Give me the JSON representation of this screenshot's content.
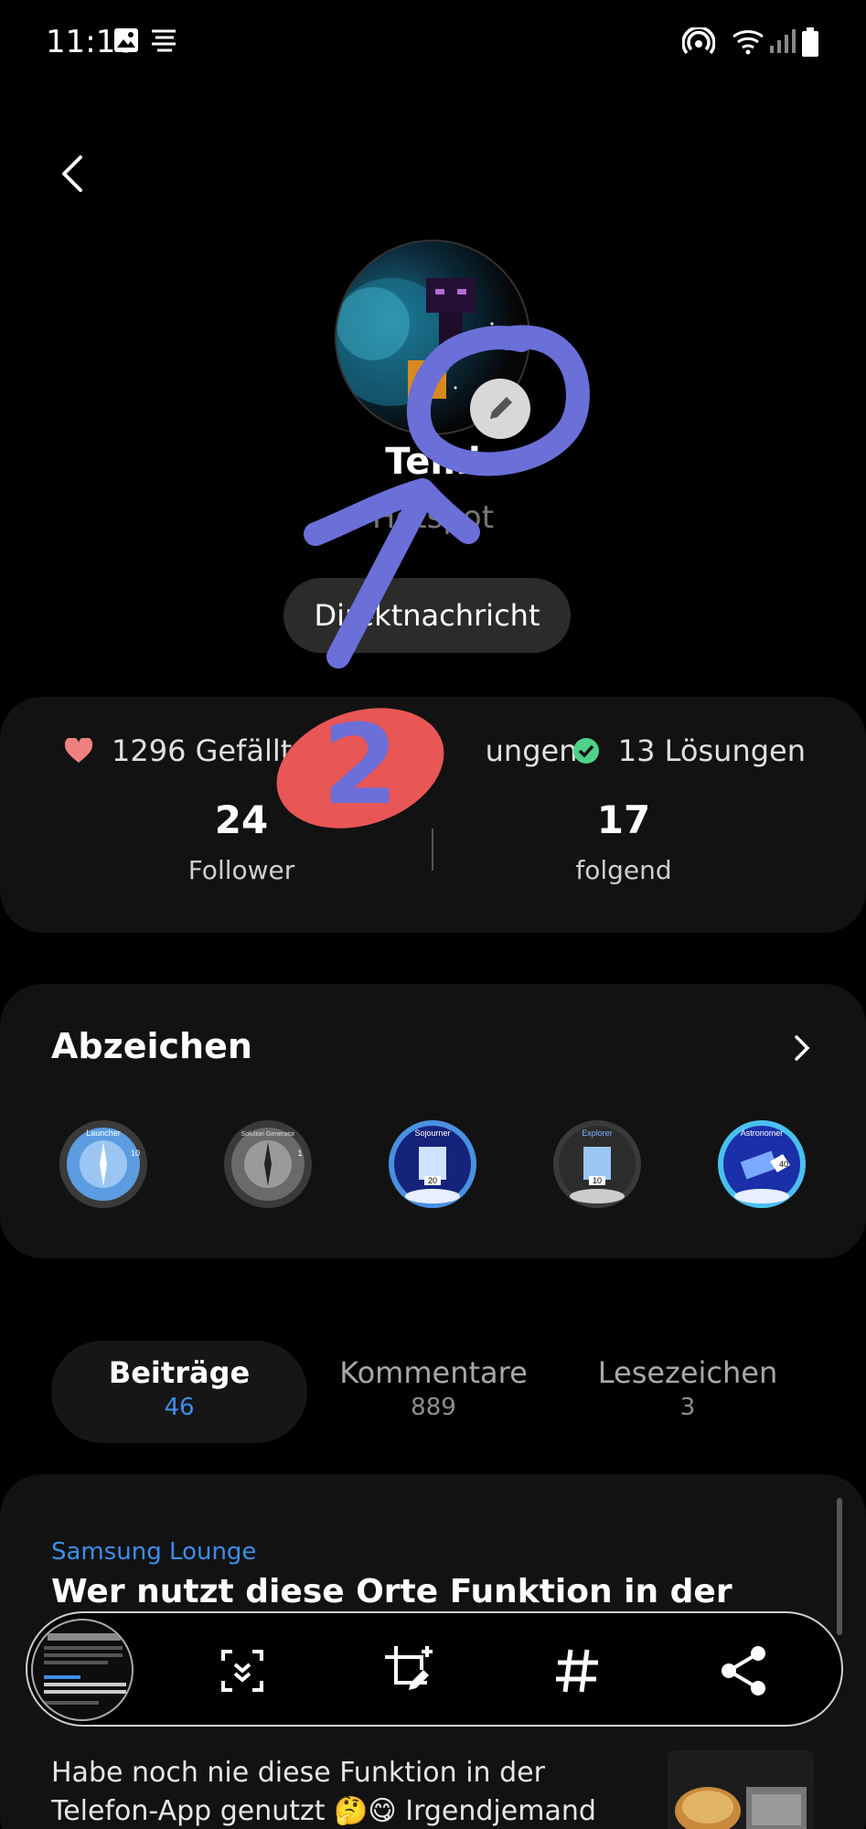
{
  "status_bar": {
    "time": "11:18"
  },
  "profile": {
    "name": "Temi",
    "rank": "Hotspot",
    "dm_label": "Direktnachricht"
  },
  "stats": {
    "likes": "1296 Gefällt mir-Angaben",
    "likes_visible": "1296 Gefällt m",
    "likes_tail": "ungen",
    "solutions": "13 Lösungen",
    "followers_count": "24",
    "followers_label": "Follower",
    "following_count": "17",
    "following_label": "folgend"
  },
  "badges": {
    "title": "Abzeichen",
    "items": [
      "Launcher",
      "Solution Generator",
      "Sojourner",
      "Explorer",
      "Astronomer"
    ],
    "level_numbers": [
      "10",
      "1",
      "20",
      "10",
      "40"
    ]
  },
  "tabs": [
    {
      "label": "Beiträge",
      "count": "46"
    },
    {
      "label": "Kommentare",
      "count": "889"
    },
    {
      "label": "Lesezeichen",
      "count": "3"
    }
  ],
  "post": {
    "category": "Samsung Lounge",
    "title": "Wer nutzt diese Orte Funktion in der",
    "body_line1": "Habe noch nie diese Funktion in der",
    "body_line2": "Telefon-App genutzt 🤔😋 Irgendjemand"
  },
  "annotations": {
    "number": "2"
  },
  "colors": {
    "accent_blue": "#3e8ee8",
    "annotation_blue": "#6b6fd8",
    "annotation_red": "#e85656",
    "heart": "#f08080",
    "check": "#4ed28a"
  }
}
